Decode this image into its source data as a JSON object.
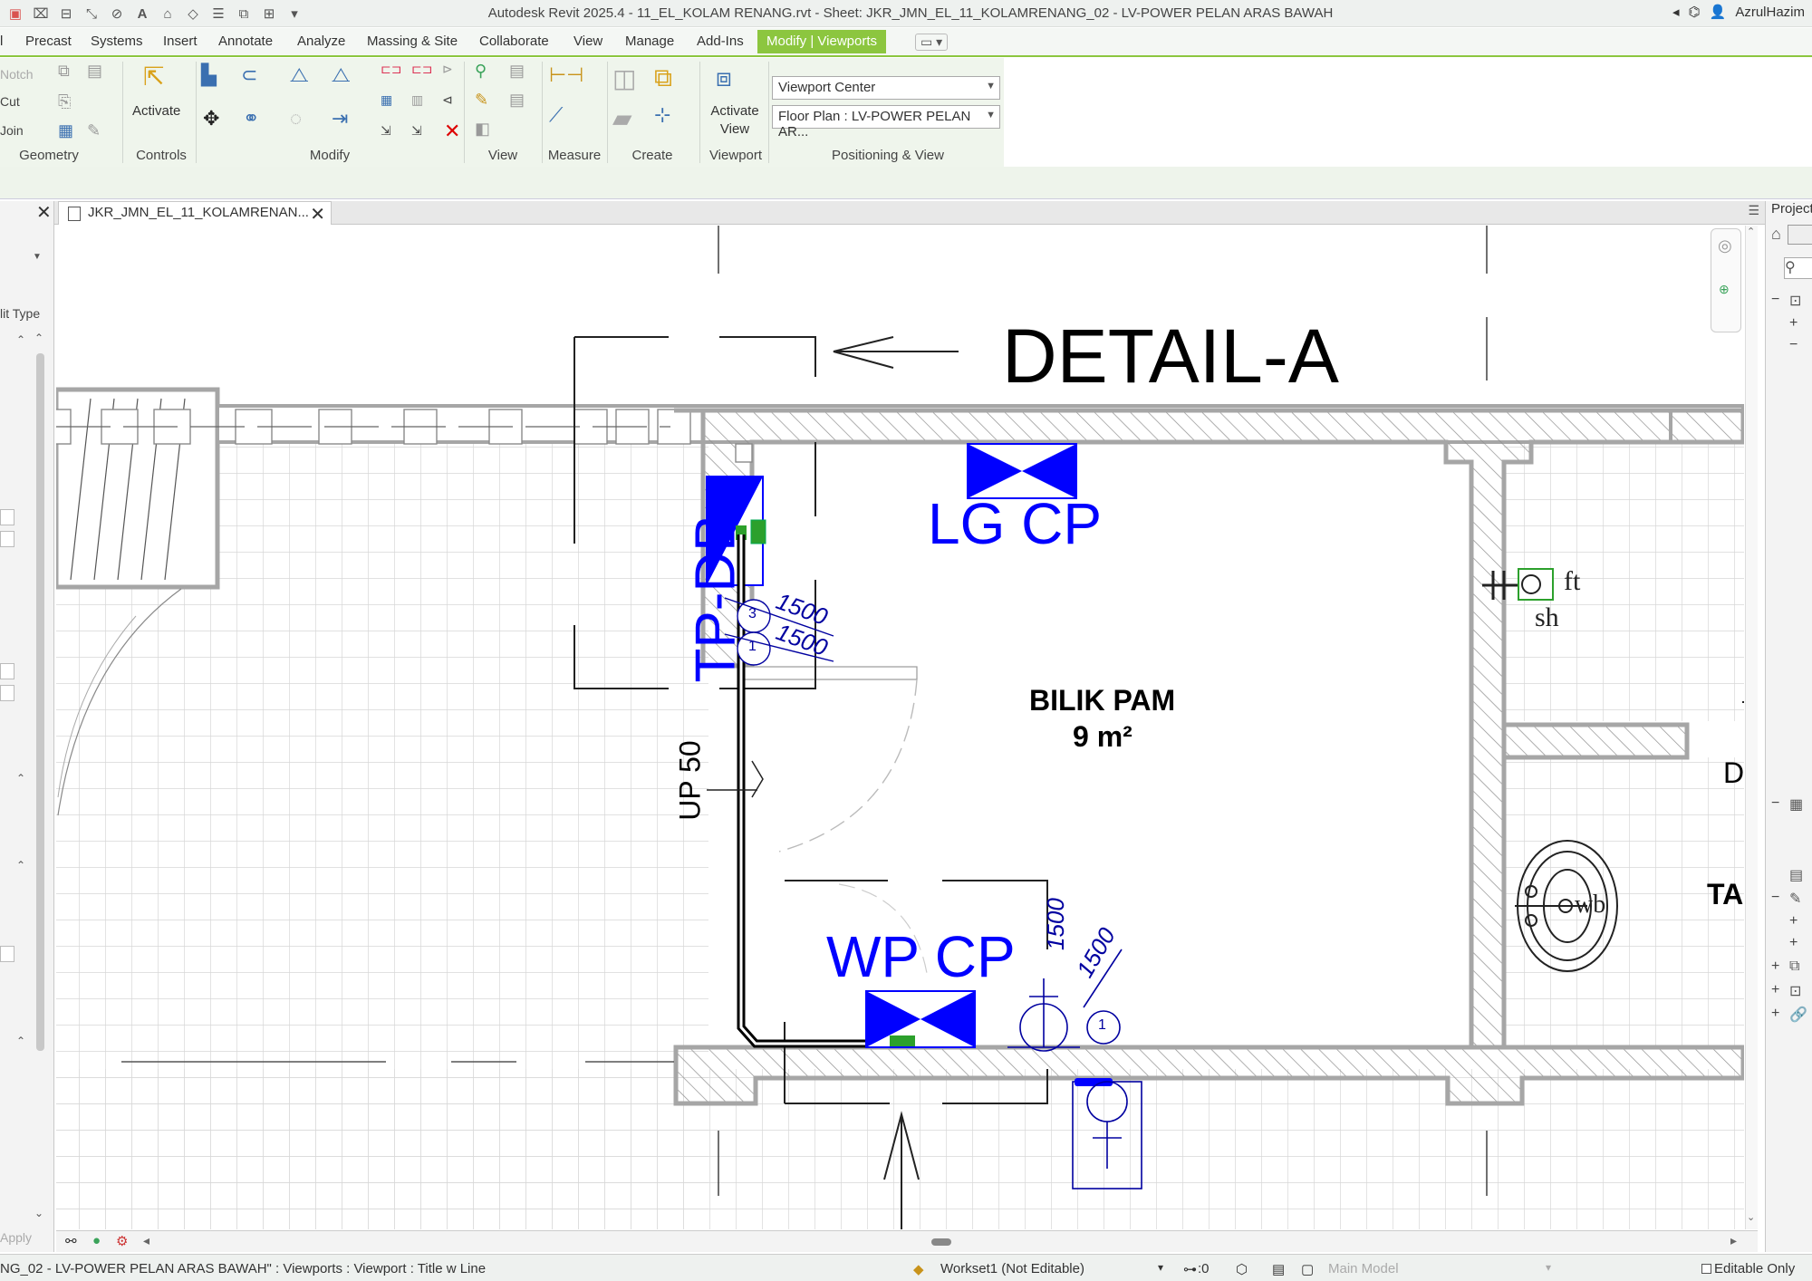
{
  "titlebar": {
    "title": "Autodesk Revit 2025.4 - 11_EL_KOLAM RENANG.rvt - Sheet: JKR_JMN_EL_11_KOLAMRENANG_02 - LV-POWER PELAN ARAS BAWAH",
    "user": "AzrulHazim"
  },
  "tabs": [
    "Precast",
    "Systems",
    "Insert",
    "Annotate",
    "Analyze",
    "Massing & Site",
    "Collaborate",
    "View",
    "Manage",
    "Add-Ins",
    "Modify | Viewports"
  ],
  "ribbon": {
    "geometry": {
      "label": "Geometry",
      "notch": "Notch",
      "cut": "Cut",
      "join": "Join"
    },
    "controls": {
      "label": "Controls",
      "activate": "Activate"
    },
    "modify": {
      "label": "Modify"
    },
    "view": {
      "label": "View"
    },
    "measure": {
      "label": "Measure"
    },
    "create": {
      "label": "Create"
    },
    "viewport": {
      "label": "Viewport",
      "activate_view_1": "Activate",
      "activate_view_2": "View"
    },
    "positioning": {
      "label": "Positioning & View",
      "dropdown1": "Viewport Center",
      "dropdown2": "Floor Plan : LV-POWER PELAN AR..."
    }
  },
  "properties": {
    "type_label": "lit Type",
    "apply": "Apply"
  },
  "view_tab": {
    "label": "JKR_JMN_EL_11_KOLAMRENAN..."
  },
  "project_browser": {
    "title": "Project"
  },
  "drawing": {
    "detail_title": "DETAIL-A",
    "lg_cp": "LG CP",
    "wp_cp": "WP CP",
    "tp_db": "TP-DB",
    "room_name": "BILIK PAM",
    "room_area": "9 m²",
    "up_label": "UP 50",
    "dim1": "1500",
    "dim2": "1500",
    "dim3": "1500",
    "dim4": "1500",
    "circuit_3": "3",
    "circuit_1a": "1",
    "circuit_1b": "1",
    "ft": "ft",
    "sh": "sh",
    "wb": "wb",
    "d_label": "D",
    "ta_label": "TA"
  },
  "statusbar": {
    "selection": "NG_02 - LV-POWER PELAN ARAS BAWAH\" : Viewports : Viewport : Title w Line",
    "workset": "Workset1 (Not Editable)",
    "zero": ":0",
    "model": "Main Model",
    "editable": "Editable Only"
  },
  "colors": {
    "accent_green": "#8cc63f",
    "symbol_blue": "#0000ff",
    "wall_gray": "#a6a6a6"
  }
}
